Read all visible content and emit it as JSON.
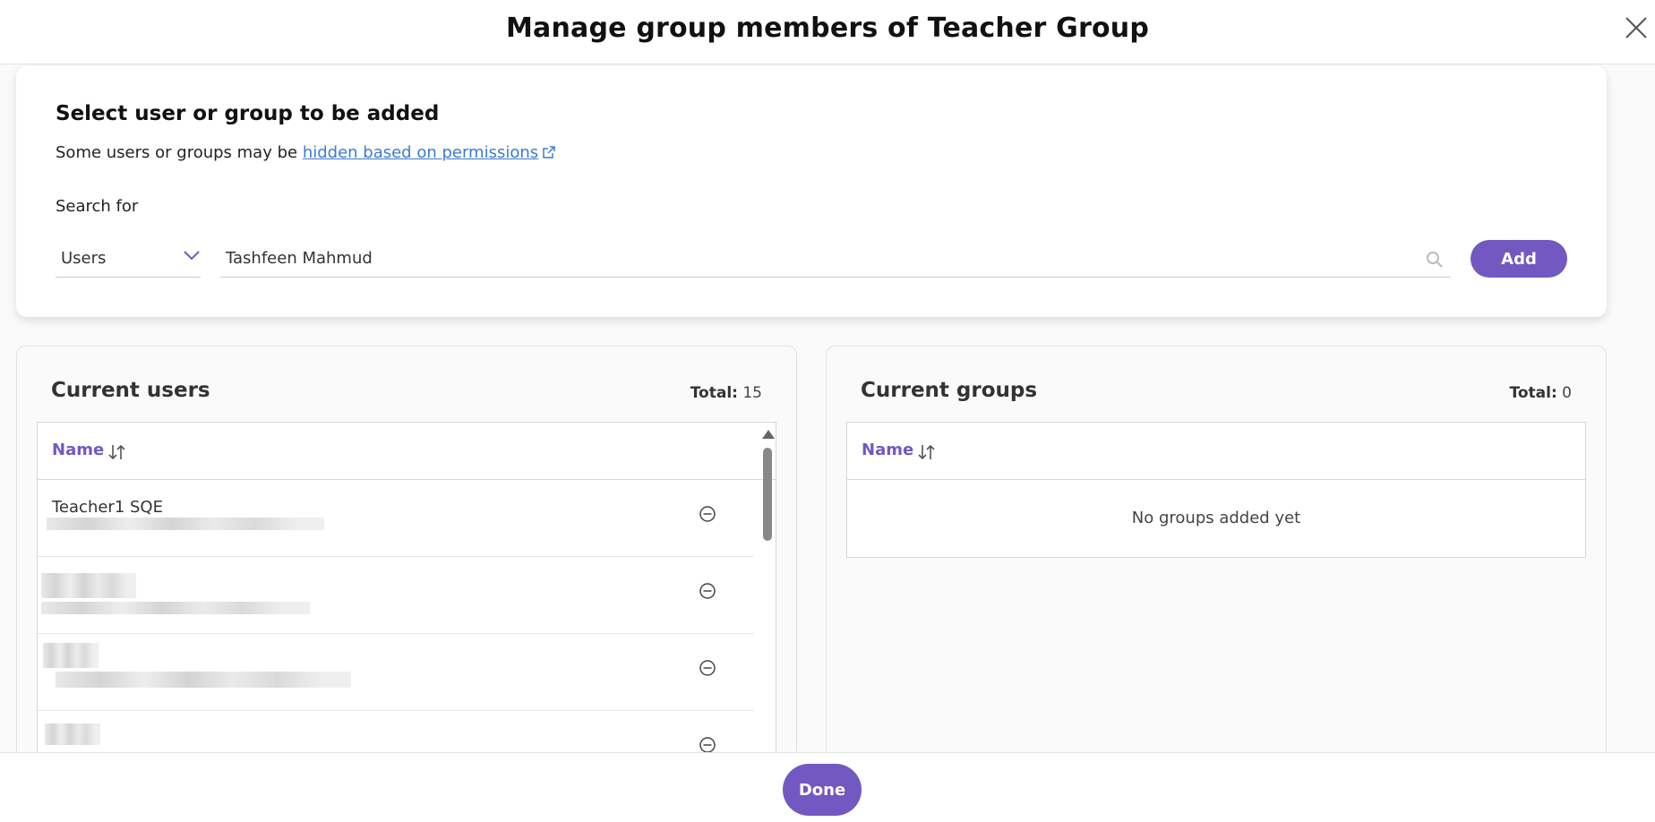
{
  "header": {
    "title": "Manage group members of Teacher Group"
  },
  "search_card": {
    "title": "Select user or group to be added",
    "hint_prefix": "Some users or groups may be ",
    "hint_link": "hidden based on permissions",
    "search_label": "Search for",
    "type_selected": "Users",
    "search_value": "Tashfeen Mahmud",
    "add_label": "Add"
  },
  "users_panel": {
    "title": "Current users",
    "total_label": "Total:",
    "total_value": "15",
    "column_name": "Name",
    "rows": [
      {
        "name": "Teacher1 SQE"
      },
      {
        "name": ""
      },
      {
        "name": ""
      },
      {
        "name": ""
      }
    ]
  },
  "groups_panel": {
    "title": "Current groups",
    "total_label": "Total:",
    "total_value": "0",
    "column_name": "Name",
    "empty_text": "No groups added yet"
  },
  "footer": {
    "done_label": "Done"
  },
  "colors": {
    "accent": "#7159c1",
    "link": "#3b7bd6"
  },
  "icons": [
    "close-icon",
    "external-link-icon",
    "chevron-down-icon",
    "search-icon",
    "sort-icon",
    "remove-circle-icon"
  ]
}
